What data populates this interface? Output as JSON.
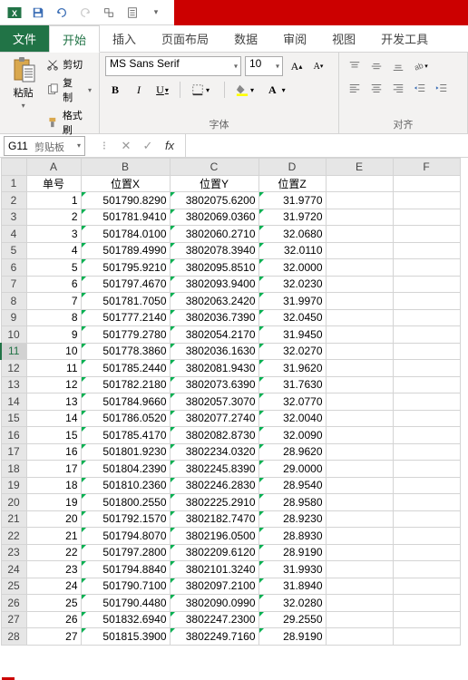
{
  "qat": {
    "save_title": "保存",
    "undo_title": "撤销",
    "redo_title": "恢复",
    "touch_title": "触摸模式",
    "customize_title": "自定义"
  },
  "tabs": {
    "file": "文件",
    "home": "开始",
    "insert": "插入",
    "page_layout": "页面布局",
    "data": "数据",
    "review": "审阅",
    "view": "视图",
    "developer": "开发工具"
  },
  "ribbon": {
    "clipboard": {
      "label": "剪贴板",
      "paste": "粘贴",
      "cut": "剪切",
      "copy": "复制",
      "format_painter": "格式刷"
    },
    "font": {
      "label": "字体",
      "name": "MS Sans Serif",
      "size": "10"
    },
    "align": {
      "label": "对齐"
    }
  },
  "namebox": "G11",
  "columns": [
    "A",
    "B",
    "C",
    "D",
    "E",
    "F"
  ],
  "headers": {
    "A": "单号",
    "B": "位置X",
    "C": "位置Y",
    "D": "位置Z"
  },
  "rows": [
    {
      "n": 1,
      "a": "",
      "b": "",
      "c": "",
      "d": "",
      "hdr": true
    },
    {
      "n": 2,
      "a": "1",
      "b": "501790.8290",
      "c": "3802075.6200",
      "d": "31.9770"
    },
    {
      "n": 3,
      "a": "2",
      "b": "501781.9410",
      "c": "3802069.0360",
      "d": "31.9720"
    },
    {
      "n": 4,
      "a": "3",
      "b": "501784.0100",
      "c": "3802060.2710",
      "d": "32.0680"
    },
    {
      "n": 5,
      "a": "4",
      "b": "501789.4990",
      "c": "3802078.3940",
      "d": "32.0110"
    },
    {
      "n": 6,
      "a": "5",
      "b": "501795.9210",
      "c": "3802095.8510",
      "d": "32.0000"
    },
    {
      "n": 7,
      "a": "6",
      "b": "501797.4670",
      "c": "3802093.9400",
      "d": "32.0230"
    },
    {
      "n": 8,
      "a": "7",
      "b": "501781.7050",
      "c": "3802063.2420",
      "d": "31.9970"
    },
    {
      "n": 9,
      "a": "8",
      "b": "501777.2140",
      "c": "3802036.7390",
      "d": "32.0450"
    },
    {
      "n": 10,
      "a": "9",
      "b": "501779.2780",
      "c": "3802054.2170",
      "d": "31.9450"
    },
    {
      "n": 11,
      "a": "10",
      "b": "501778.3860",
      "c": "3802036.1630",
      "d": "32.0270",
      "sel": true
    },
    {
      "n": 12,
      "a": "11",
      "b": "501785.2440",
      "c": "3802081.9430",
      "d": "31.9620"
    },
    {
      "n": 13,
      "a": "12",
      "b": "501782.2180",
      "c": "3802073.6390",
      "d": "31.7630"
    },
    {
      "n": 14,
      "a": "13",
      "b": "501784.9660",
      "c": "3802057.3070",
      "d": "32.0770"
    },
    {
      "n": 15,
      "a": "14",
      "b": "501786.0520",
      "c": "3802077.2740",
      "d": "32.0040"
    },
    {
      "n": 16,
      "a": "15",
      "b": "501785.4170",
      "c": "3802082.8730",
      "d": "32.0090"
    },
    {
      "n": 17,
      "a": "16",
      "b": "501801.9230",
      "c": "3802234.0320",
      "d": "28.9620"
    },
    {
      "n": 18,
      "a": "17",
      "b": "501804.2390",
      "c": "3802245.8390",
      "d": "29.0000"
    },
    {
      "n": 19,
      "a": "18",
      "b": "501810.2360",
      "c": "3802246.2830",
      "d": "28.9540"
    },
    {
      "n": 20,
      "a": "19",
      "b": "501800.2550",
      "c": "3802225.2910",
      "d": "28.9580"
    },
    {
      "n": 21,
      "a": "20",
      "b": "501792.1570",
      "c": "3802182.7470",
      "d": "28.9230"
    },
    {
      "n": 22,
      "a": "21",
      "b": "501794.8070",
      "c": "3802196.0500",
      "d": "28.8930"
    },
    {
      "n": 23,
      "a": "22",
      "b": "501797.2800",
      "c": "3802209.6120",
      "d": "28.9190"
    },
    {
      "n": 24,
      "a": "23",
      "b": "501794.8840",
      "c": "3802101.3240",
      "d": "31.9930"
    },
    {
      "n": 25,
      "a": "24",
      "b": "501790.7100",
      "c": "3802097.2100",
      "d": "31.8940"
    },
    {
      "n": 26,
      "a": "25",
      "b": "501790.4480",
      "c": "3802090.0990",
      "d": "32.0280"
    },
    {
      "n": 27,
      "a": "26",
      "b": "501832.6940",
      "c": "3802247.2300",
      "d": "29.2550"
    },
    {
      "n": 28,
      "a": "27",
      "b": "501815.3900",
      "c": "3802249.7160",
      "d": "28.9190"
    }
  ]
}
